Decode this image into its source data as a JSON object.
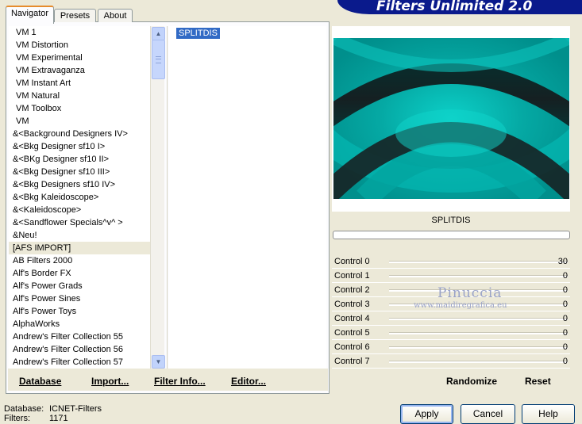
{
  "header": {
    "title": "Filters Unlimited 2.0"
  },
  "tabs": [
    {
      "label": "Navigator",
      "active": true
    },
    {
      "label": "Presets",
      "active": false
    },
    {
      "label": "About",
      "active": false
    }
  ],
  "categories": [
    "VM 1",
    "VM Distortion",
    "VM Experimental",
    "VM Extravaganza",
    "VM Instant Art",
    "VM Natural",
    "VM Toolbox",
    "VM",
    "&<Background Designers IV>",
    "&<Bkg Designer sf10 I>",
    "&<BKg Designer sf10 II>",
    "&<Bkg Designer sf10 III>",
    "&<Bkg Designers sf10 IV>",
    "&<Bkg Kaleidoscope>",
    "&<Kaleidoscope>",
    "&<Sandflower Specials^v^ >",
    "&Neu!",
    "[AFS IMPORT]",
    "AB Filters 2000",
    "Alf's Border FX",
    "Alf's Power Grads",
    "Alf's Power Sines",
    "Alf's Power Toys",
    "AlphaWorks",
    "Andrew's Filter Collection 55",
    "Andrew's Filter Collection 56",
    "Andrew's Filter Collection 57"
  ],
  "selected_category": "[AFS IMPORT]",
  "filters": [
    "SPLITDIS"
  ],
  "selected_filter": "SPLITDIS",
  "toolbar": {
    "database": "Database",
    "import": "Import...",
    "filter_info": "Filter Info...",
    "editor": "Editor..."
  },
  "preview": {
    "filter_name": "SPLITDIS",
    "progress": 0
  },
  "controls": [
    {
      "label": "Control 0",
      "value": "30"
    },
    {
      "label": "Control 1",
      "value": "0"
    },
    {
      "label": "Control 2",
      "value": "0"
    },
    {
      "label": "Control 3",
      "value": "0"
    },
    {
      "label": "Control 4",
      "value": "0"
    },
    {
      "label": "Control 5",
      "value": "0"
    },
    {
      "label": "Control 6",
      "value": "0"
    },
    {
      "label": "Control 7",
      "value": "0"
    }
  ],
  "watermark": {
    "name": "Pinuccia",
    "url": "www.maidiregrafica.eu"
  },
  "actions": {
    "randomize": "Randomize",
    "reset": "Reset"
  },
  "status": {
    "database_label": "Database:",
    "database_value": "ICNET-Filters",
    "filters_label": "Filters:",
    "filters_value": "1171"
  },
  "buttons": {
    "apply": "Apply",
    "cancel": "Cancel",
    "help": "Help"
  },
  "colors": {
    "banner": "#0a1a8c",
    "selection": "#316ac5",
    "preview_teal": "#00a3a0",
    "tab_highlight": "#e68b2c"
  }
}
